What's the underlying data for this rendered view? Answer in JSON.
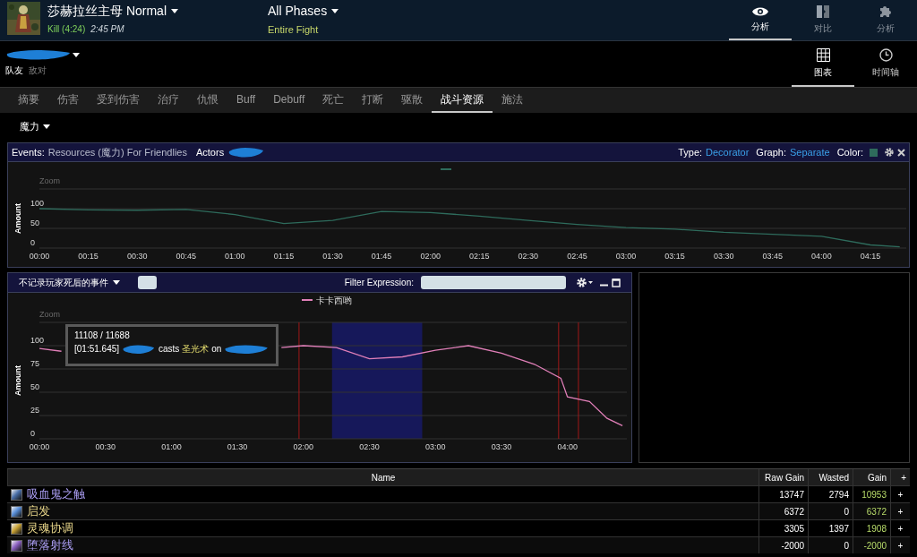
{
  "header": {
    "boss_name": "莎赫拉丝主母 Normal",
    "result": "Kill (4:24)",
    "time": "2:45 PM",
    "phase": "All Phases",
    "phase_range": "Entire Fight"
  },
  "top_nav": [
    {
      "label": "分析",
      "selected": true
    },
    {
      "label": "对比",
      "selected": false
    },
    {
      "label": "分析",
      "selected": false
    }
  ],
  "side_toggle": [
    {
      "label": "队友",
      "selected": true
    },
    {
      "label": "敌对",
      "selected": false
    }
  ],
  "view_nav": [
    {
      "label": "图表",
      "selected": true
    },
    {
      "label": "时间轴",
      "selected": false
    }
  ],
  "tabs": [
    {
      "label": "摘要",
      "selected": false
    },
    {
      "label": "伤害",
      "selected": false
    },
    {
      "label": "受到伤害",
      "selected": false
    },
    {
      "label": "治疗",
      "selected": false
    },
    {
      "label": "仇恨",
      "selected": false
    },
    {
      "label": "Buff",
      "selected": false
    },
    {
      "label": "Debuff",
      "selected": false
    },
    {
      "label": "死亡",
      "selected": false
    },
    {
      "label": "打断",
      "selected": false
    },
    {
      "label": "驱散",
      "selected": false
    },
    {
      "label": "战斗资源",
      "selected": true
    },
    {
      "label": "施法",
      "selected": false
    }
  ],
  "resource_dropdown": "魔力",
  "events_panel": {
    "events_label": "Events:",
    "events_text": "Resources (魔力) For Friendlies",
    "actors_label": "Actors",
    "type_label": "Type:",
    "type_value": "Decorator",
    "graph_label": "Graph:",
    "graph_value": "Separate",
    "color_label": "Color:",
    "color": "#2e6b5c",
    "zoom_label": "Zoom",
    "chart_data": {
      "type": "line",
      "grid": true,
      "ylabel": "Amount",
      "xlim": [
        0,
        266
      ],
      "ylim": [
        0,
        150
      ],
      "yticks": [
        0,
        50,
        100
      ],
      "xticks": [
        {
          "value": 0,
          "label": "00:00"
        },
        {
          "value": 15,
          "label": "00:15"
        },
        {
          "value": 30,
          "label": "00:30"
        },
        {
          "value": 45,
          "label": "00:45"
        },
        {
          "value": 60,
          "label": "01:00"
        },
        {
          "value": 75,
          "label": "01:15"
        },
        {
          "value": 90,
          "label": "01:30"
        },
        {
          "value": 105,
          "label": "01:45"
        },
        {
          "value": 120,
          "label": "02:00"
        },
        {
          "value": 135,
          "label": "02:15"
        },
        {
          "value": 150,
          "label": "02:30"
        },
        {
          "value": 165,
          "label": "02:45"
        },
        {
          "value": 180,
          "label": "03:00"
        },
        {
          "value": 195,
          "label": "03:15"
        },
        {
          "value": 210,
          "label": "03:30"
        },
        {
          "value": 225,
          "label": "03:45"
        },
        {
          "value": 240,
          "label": "04:00"
        },
        {
          "value": 255,
          "label": "04:15"
        }
      ],
      "x": [
        0,
        15,
        30,
        45,
        60,
        75,
        90,
        105,
        120,
        135,
        150,
        165,
        180,
        195,
        210,
        225,
        240,
        255,
        264
      ],
      "series": [
        {
          "color": "#2e6b5c",
          "values": [
            100,
            97,
            96,
            98,
            85,
            62,
            70,
            93,
            90,
            81,
            70,
            60,
            52,
            48,
            40,
            35,
            30,
            8,
            3
          ]
        }
      ]
    }
  },
  "events_filter": {
    "death_option": "不记录玩家死后的事件",
    "filter_label": "Filter Expression:",
    "zoom_label": "Zoom",
    "chart_data": {
      "type": "line",
      "grid": true,
      "ylabel": "Amount",
      "xlim": [
        0,
        267
      ],
      "ylim": [
        0,
        125
      ],
      "yticks": [
        0,
        25,
        50,
        75,
        100
      ],
      "xticks": [
        {
          "value": 0,
          "label": "00:00"
        },
        {
          "value": 30,
          "label": "00:30"
        },
        {
          "value": 60,
          "label": "01:00"
        },
        {
          "value": 90,
          "label": "01:30"
        },
        {
          "value": 120,
          "label": "02:00"
        },
        {
          "value": 150,
          "label": "02:30"
        },
        {
          "value": 180,
          "label": "03:00"
        },
        {
          "value": 210,
          "label": "03:30"
        },
        {
          "value": 240,
          "label": "04:00"
        }
      ],
      "x": [
        0,
        10,
        60,
        110,
        120,
        135,
        150,
        165,
        180,
        195,
        210,
        225,
        237,
        240,
        250,
        258,
        265
      ],
      "series": [
        {
          "name": "卡卡西哟",
          "color": "#e07fb8",
          "values": [
            97,
            94,
            null,
            98,
            100,
            98,
            86,
            88,
            95,
            100,
            92,
            80,
            65,
            45,
            40,
            22,
            14
          ]
        }
      ],
      "bands": [
        {
          "axis": "x",
          "from": 133,
          "to": 174,
          "color": "#16185a"
        }
      ],
      "ref_lines": [
        {
          "axis": "x",
          "value": 118,
          "color": "#a01818"
        },
        {
          "axis": "x",
          "value": 236,
          "color": "#a01818"
        },
        {
          "axis": "x",
          "value": 245,
          "color": "#a01818"
        }
      ]
    },
    "tooltip": {
      "value": "11108 / 11688",
      "time": "[01:51.645]",
      "verb": "casts",
      "spell": "圣光术",
      "preposition": "on"
    }
  },
  "table": {
    "columns": [
      "Name",
      "Raw Gain",
      "Wasted",
      "Gain",
      "+"
    ],
    "rows": [
      {
        "name": "吸血鬼之触",
        "color": "#a99cf0",
        "raw_gain": "13747",
        "wasted": "2794",
        "gain": "10953",
        "action": "+"
      },
      {
        "name": "启发",
        "color": "#e8d68a",
        "raw_gain": "6372",
        "wasted": "0",
        "gain": "6372",
        "action": "+"
      },
      {
        "name": "灵魂协调",
        "color": "#e8d68a",
        "raw_gain": "3305",
        "wasted": "1397",
        "gain": "1908",
        "action": "+"
      },
      {
        "name": "堕落射线",
        "color": "#a99cf0",
        "raw_gain": "-2000",
        "wasted": "0",
        "gain": "-2000",
        "action": "+"
      }
    ]
  }
}
